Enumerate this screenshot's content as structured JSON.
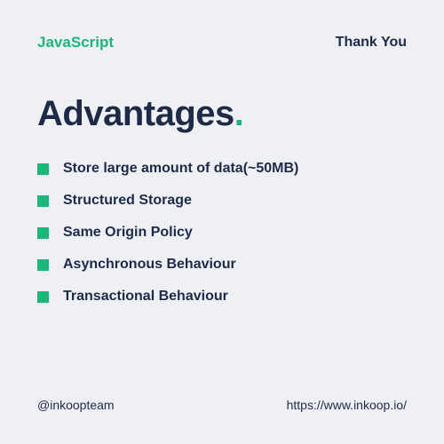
{
  "header": {
    "brand": "JavaScript",
    "thanks": "Thank You"
  },
  "title": {
    "text": "Advantages",
    "dot": "."
  },
  "items": [
    "Store large amount of data(~50MB)",
    "Structured Storage",
    "Same Origin Policy",
    "Asynchronous Behaviour",
    "Transactional Behaviour"
  ],
  "footer": {
    "handle": "@inkoopteam",
    "url": "https://www.inkoop.io/"
  }
}
